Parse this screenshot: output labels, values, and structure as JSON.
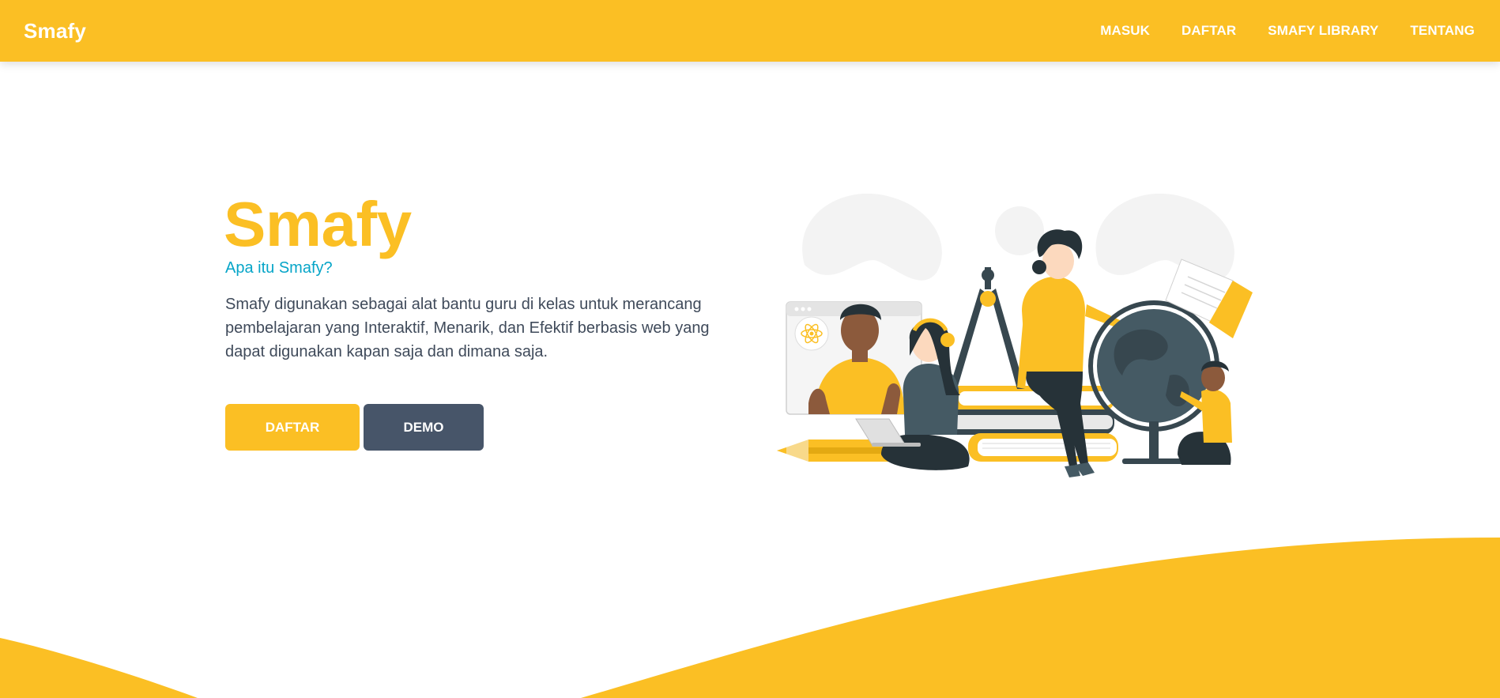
{
  "nav": {
    "brand": "Smafy",
    "links": [
      "MASUK",
      "DAFTAR",
      "SMAFY LIBRARY",
      "TENTANG"
    ]
  },
  "hero": {
    "title": "Smafy",
    "subtitle": "Apa itu Smafy?",
    "description": "Smafy digunakan sebagai alat bantu guru di kelas untuk merancang pembelajaran yang Interaktif, Menarik, dan Efektif berbasis web yang dapat digunakan kapan saja dan dimana saja.",
    "buttons": {
      "primary": "DAFTAR",
      "secondary": "DEMO"
    }
  },
  "colors": {
    "brand_yellow": "#FBBF24",
    "accent_cyan": "#06A5C8",
    "slate": "#475569",
    "text": "#3F4A5A"
  },
  "illustration": {
    "name": "classroom-learning-illustration",
    "elements": [
      "atom-icon",
      "compass",
      "globe",
      "open-book",
      "pencil",
      "laptop",
      "stacked-books"
    ]
  }
}
